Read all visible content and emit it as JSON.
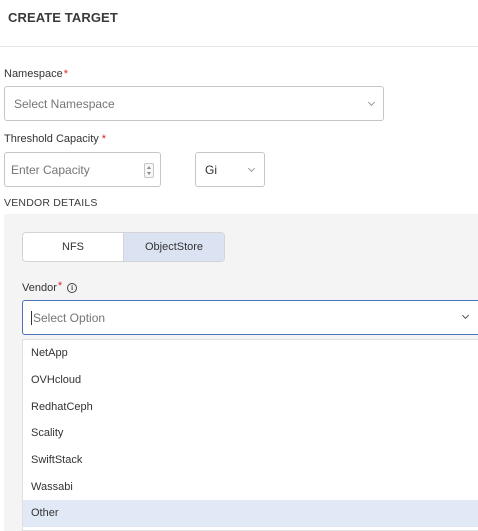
{
  "header": {
    "title": "CREATE TARGET"
  },
  "namespace": {
    "label": "Namespace",
    "required_mark": "*",
    "placeholder": "Select Namespace"
  },
  "threshold": {
    "label": "Threshold Capacity",
    "required_mark": "*",
    "placeholder": "Enter Capacity",
    "unit": "Gi"
  },
  "vendor_details": {
    "title": "VENDOR DETAILS",
    "tabs": [
      {
        "label": "NFS",
        "active": false
      },
      {
        "label": "ObjectStore",
        "active": true
      }
    ],
    "vendor": {
      "label": "Vendor",
      "required_mark": "*",
      "info_icon": "i",
      "placeholder": "Select Option",
      "options": [
        "NetApp",
        "OVHcloud",
        "RedhatCeph",
        "Scality",
        "SwiftStack",
        "Wassabi",
        "Other"
      ],
      "highlighted_option": "Other"
    }
  },
  "colors": {
    "required": "#d9241c",
    "focus_border": "#4a72b8",
    "active_tab": "#dbe3f3",
    "option_highlight": "#e2e9f6"
  }
}
